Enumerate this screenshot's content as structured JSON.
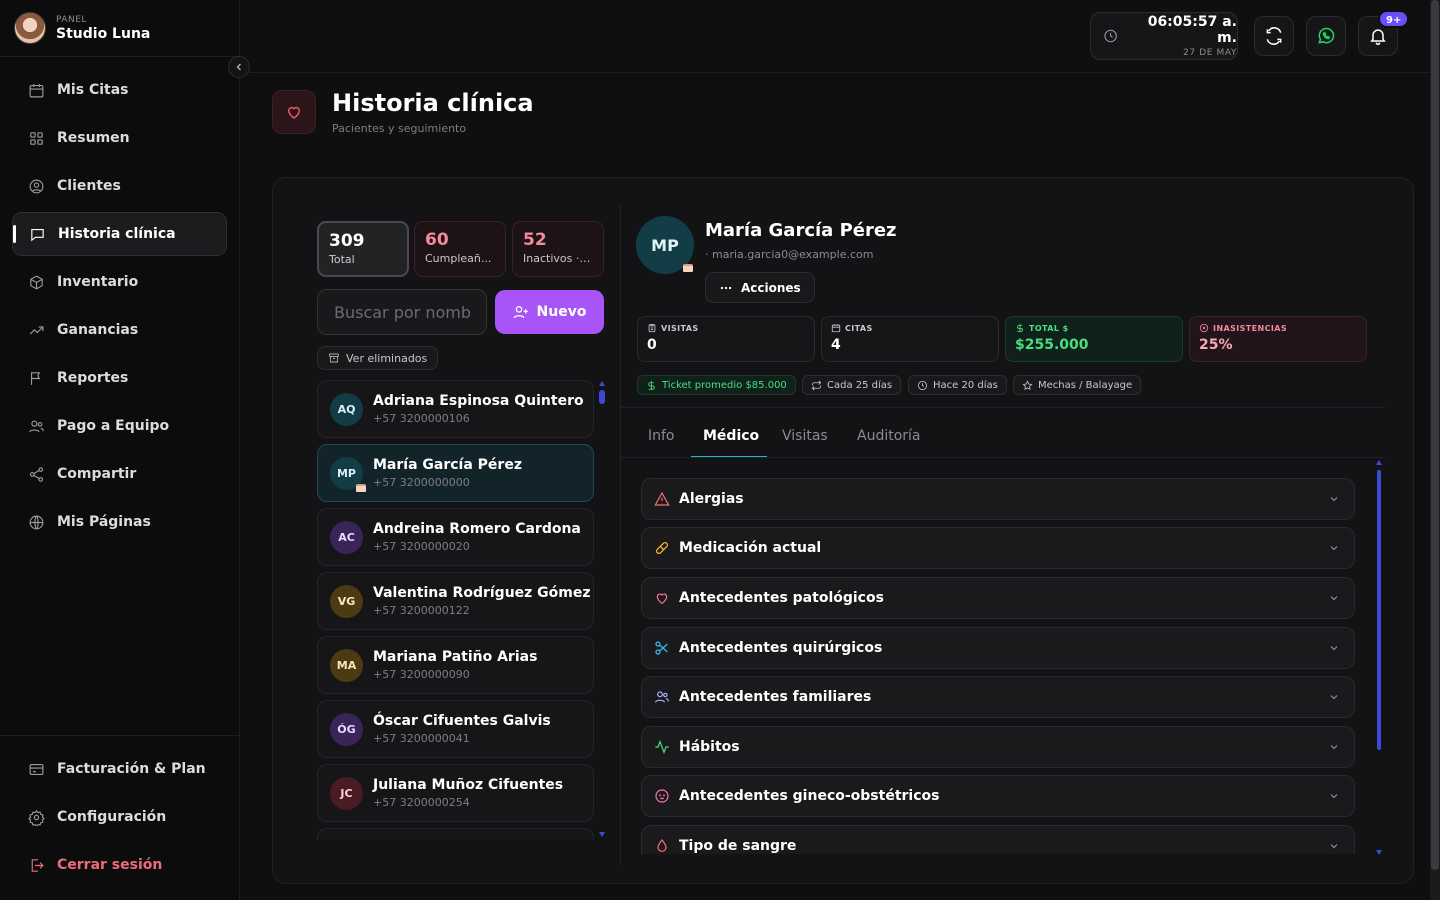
{
  "brand": {
    "label": "PANEL",
    "name": "Studio Luna"
  },
  "sidebar": {
    "items": [
      {
        "label": "Mis Citas",
        "icon": "calendar-icon"
      },
      {
        "label": "Resumen",
        "icon": "grid-icon"
      },
      {
        "label": "Clientes",
        "icon": "user-circle-icon"
      },
      {
        "label": "Historia clínica",
        "icon": "chat-icon",
        "active": true
      },
      {
        "label": "Inventario",
        "icon": "box-icon"
      },
      {
        "label": "Ganancias",
        "icon": "trending-up-icon"
      },
      {
        "label": "Reportes",
        "icon": "flag-icon"
      },
      {
        "label": "Pago a Equipo",
        "icon": "users-icon"
      },
      {
        "label": "Compartir",
        "icon": "share-icon"
      },
      {
        "label": "Mis Páginas",
        "icon": "globe-icon"
      }
    ],
    "footer": [
      {
        "label": "Facturación & Plan",
        "icon": "credit-card-icon"
      },
      {
        "label": "Configuración",
        "icon": "settings-icon"
      },
      {
        "label": "Cerrar sesión",
        "icon": "logout-icon"
      }
    ]
  },
  "topbar": {
    "time": "06:05:57 a. m.",
    "date": "27 DE MAY",
    "notifications_badge": "9+"
  },
  "header": {
    "title": "Historia clínica",
    "subtitle": "Pacientes y seguimiento"
  },
  "stats": {
    "total": {
      "value": "309",
      "label": "Total"
    },
    "birthdays": {
      "value": "60",
      "label": "Cumpleañ..."
    },
    "inactive": {
      "value": "52",
      "label": "Inactivos · ..."
    }
  },
  "search": {
    "placeholder": "Buscar por nombre"
  },
  "new_button": "Nuevo",
  "deleted_button": "Ver eliminados",
  "patients": [
    {
      "initials": "AQ",
      "name": "Adriana Espinosa Quintero",
      "phone": "+57 3200000106"
    },
    {
      "initials": "MP",
      "name": "María García Pérez",
      "phone": "+57 3200000000"
    },
    {
      "initials": "AC",
      "name": "Andreina Romero Cardona",
      "phone": "+57 3200000020"
    },
    {
      "initials": "VG",
      "name": "Valentina Rodríguez Gómez",
      "phone": "+57 3200000122"
    },
    {
      "initials": "MA",
      "name": "Mariana Patiño Arias",
      "phone": "+57 3200000090"
    },
    {
      "initials": "ÓG",
      "name": "Óscar Cifuentes Galvis",
      "phone": "+57 3200000041"
    },
    {
      "initials": "JC",
      "name": "Juliana Muñoz Cifuentes",
      "phone": "+57 3200000254"
    }
  ],
  "detail": {
    "initials": "MP",
    "name": "María García Pérez",
    "email": "· maria.garcia0@example.com",
    "actions_label": "Acciones",
    "kpis": [
      {
        "label": "VISITAS",
        "value": "0"
      },
      {
        "label": "CITAS",
        "value": "4"
      },
      {
        "label": "TOTAL $",
        "value": "$255.000"
      },
      {
        "label": "INASISTENCIAS",
        "value": "25%"
      }
    ],
    "chips": [
      "Ticket promedio $85.000",
      "Cada 25 días",
      "Hace 20 días",
      "Mechas / Balayage"
    ],
    "tabs": [
      "Info",
      "Médico",
      "Visitas",
      "Auditoría"
    ],
    "active_tab": "Médico",
    "sections": [
      "Alergias",
      "Medicación actual",
      "Antecedentes patológicos",
      "Antecedentes quirúrgicos",
      "Antecedentes familiares",
      "Hábitos",
      "Antecedentes gineco-obstétricos",
      "Tipo de sangre"
    ]
  },
  "colors": {
    "accent_purple": "#a855f7",
    "accent_teal": "#22b5cf",
    "success_green": "#4ade80",
    "danger_pink": "#f58a9c",
    "background": "#0f0f10"
  }
}
